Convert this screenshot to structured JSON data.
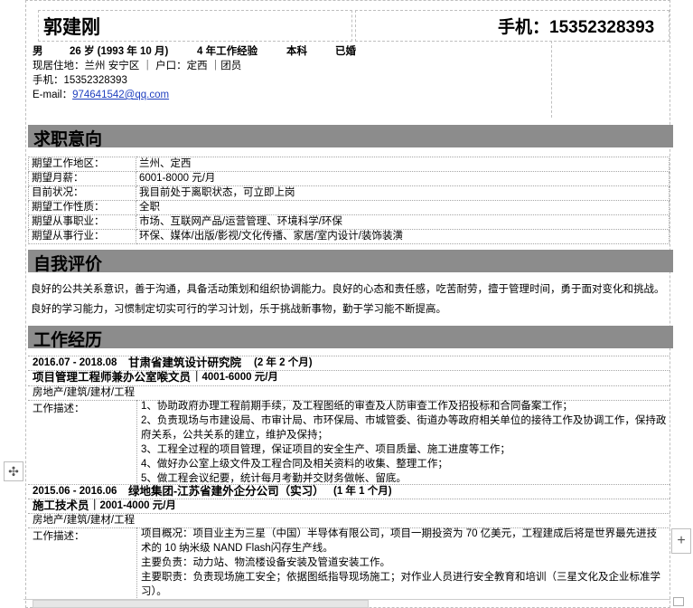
{
  "header": {
    "name": "郭建刚",
    "phone_label": "手机：15352328393"
  },
  "basic": {
    "gender": "男",
    "age": "26 岁 (1993 年 10 月)",
    "experience": "4 年工作经验",
    "degree": "本科",
    "marital": "已婚",
    "residence": "现居住地：兰州 安宁区 ｜ 户口：定西 ｜团员",
    "mobile": "手机：15352328393",
    "email_label": "E-mail：",
    "email": "974641542@qq.com"
  },
  "intention": {
    "title": "求职意向",
    "rows": [
      {
        "k": "期望工作地区：",
        "v": "兰州、定西"
      },
      {
        "k": "期望月薪：",
        "v": "6001-8000 元/月"
      },
      {
        "k": "目前状况：",
        "v": "我目前处于离职状态，可立即上岗"
      },
      {
        "k": "期望工作性质：",
        "v": "全职"
      },
      {
        "k": "期望从事职业：",
        "v": "市场、互联网产品/运营管理、环境科学/环保"
      },
      {
        "k": "期望从事行业：",
        "v": "环保、媒体/出版/影视/文化传播、家居/室内设计/装饰装潢"
      }
    ]
  },
  "self": {
    "title": "自我评价",
    "text": "良好的公共关系意识，善于沟通，具备活动策划和组织协调能力。良好的心态和责任感，吃苦耐劳，擅于管理时间，勇于面对变化和挑战。良好的学习能力，习惯制定切实可行的学习计划，乐于挑战新事物，勤于学习能不断提高。"
  },
  "work": {
    "title": "工作经历",
    "jobs": [
      {
        "period": "2016.07 - 2018.08",
        "company": "甘肃省建筑设计研究院",
        "duration": "(2 年 2 个月)",
        "position": "项目管理工程师兼办公室喉文员",
        "salary": "｜4001-6000 元/月",
        "industry": "房地产/建筑/建材/工程",
        "desc_label": "工作描述：",
        "desc": [
          "1、协助政府办理工程前期手续，及工程图纸的审查及人防审查工作及招投标和合同备案工作；",
          "2、负责现场与市建设局、市审计局、市环保局、市城管委、街道办等政府相关单位的接待工作及协调工作，保持政府关系，公共关系的建立，维护及保持；",
          "3、工程全过程的项目管理，保证项目的安全生产、项目质量、施工进度等工作；",
          "4、做好办公室上级文件及工程合同及相关资料的收集、整理工作；",
          "5、做工程会议纪要，统计每月考勤并交财务做帐、留底。"
        ]
      },
      {
        "period": "2015.06 - 2016.06",
        "company": "绿地集团-江苏省建外企分公司（实习）",
        "duration": "(1 年 1 个月)",
        "position": "施工技术员",
        "salary": "｜2001-4000 元/月",
        "industry": "房地产/建筑/建材/工程",
        "desc_label": "工作描述：",
        "desc": [
          "项目概况：项目业主为三星（中国）半导体有限公司，项目一期投资为 70 亿美元，工程建成后将是世界最先进技术的 10 纳米级 NAND Flash闪存生产线。",
          "主要负责：动力站、物流楼设备安装及管道安装工作。",
          "主要职责：负责现场施工安全；依据图纸指导现场施工；对作业人员进行安全教育和培训（三星文化及企业标准学习）。"
        ]
      }
    ]
  },
  "ui": {
    "move_icon": "move-icon",
    "add_icon": "add-icon"
  }
}
